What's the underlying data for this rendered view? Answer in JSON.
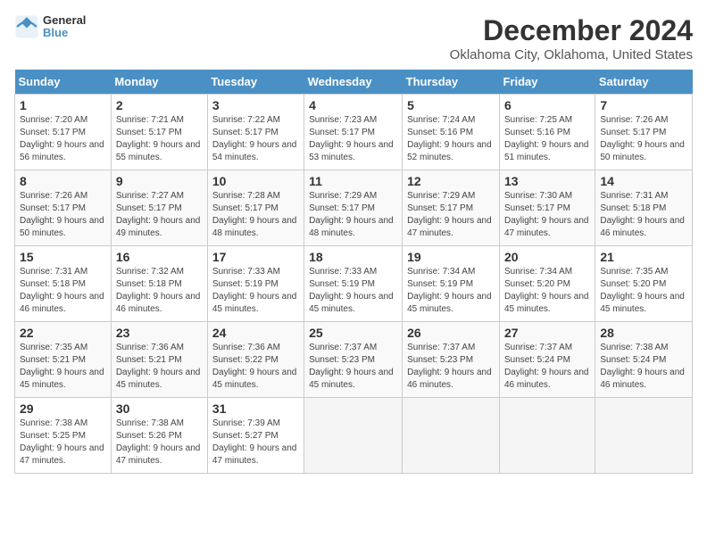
{
  "logo": {
    "text1": "General",
    "text2": "Blue"
  },
  "title": "December 2024",
  "subtitle": "Oklahoma City, Oklahoma, United States",
  "weekdays": [
    "Sunday",
    "Monday",
    "Tuesday",
    "Wednesday",
    "Thursday",
    "Friday",
    "Saturday"
  ],
  "weeks": [
    [
      {
        "day": "1",
        "sunrise": "7:20 AM",
        "sunset": "5:17 PM",
        "daylight": "9 hours and 56 minutes."
      },
      {
        "day": "2",
        "sunrise": "7:21 AM",
        "sunset": "5:17 PM",
        "daylight": "9 hours and 55 minutes."
      },
      {
        "day": "3",
        "sunrise": "7:22 AM",
        "sunset": "5:17 PM",
        "daylight": "9 hours and 54 minutes."
      },
      {
        "day": "4",
        "sunrise": "7:23 AM",
        "sunset": "5:17 PM",
        "daylight": "9 hours and 53 minutes."
      },
      {
        "day": "5",
        "sunrise": "7:24 AM",
        "sunset": "5:16 PM",
        "daylight": "9 hours and 52 minutes."
      },
      {
        "day": "6",
        "sunrise": "7:25 AM",
        "sunset": "5:16 PM",
        "daylight": "9 hours and 51 minutes."
      },
      {
        "day": "7",
        "sunrise": "7:26 AM",
        "sunset": "5:17 PM",
        "daylight": "9 hours and 50 minutes."
      }
    ],
    [
      {
        "day": "8",
        "sunrise": "7:26 AM",
        "sunset": "5:17 PM",
        "daylight": "9 hours and 50 minutes."
      },
      {
        "day": "9",
        "sunrise": "7:27 AM",
        "sunset": "5:17 PM",
        "daylight": "9 hours and 49 minutes."
      },
      {
        "day": "10",
        "sunrise": "7:28 AM",
        "sunset": "5:17 PM",
        "daylight": "9 hours and 48 minutes."
      },
      {
        "day": "11",
        "sunrise": "7:29 AM",
        "sunset": "5:17 PM",
        "daylight": "9 hours and 48 minutes."
      },
      {
        "day": "12",
        "sunrise": "7:29 AM",
        "sunset": "5:17 PM",
        "daylight": "9 hours and 47 minutes."
      },
      {
        "day": "13",
        "sunrise": "7:30 AM",
        "sunset": "5:17 PM",
        "daylight": "9 hours and 47 minutes."
      },
      {
        "day": "14",
        "sunrise": "7:31 AM",
        "sunset": "5:18 PM",
        "daylight": "9 hours and 46 minutes."
      }
    ],
    [
      {
        "day": "15",
        "sunrise": "7:31 AM",
        "sunset": "5:18 PM",
        "daylight": "9 hours and 46 minutes."
      },
      {
        "day": "16",
        "sunrise": "7:32 AM",
        "sunset": "5:18 PM",
        "daylight": "9 hours and 46 minutes."
      },
      {
        "day": "17",
        "sunrise": "7:33 AM",
        "sunset": "5:19 PM",
        "daylight": "9 hours and 45 minutes."
      },
      {
        "day": "18",
        "sunrise": "7:33 AM",
        "sunset": "5:19 PM",
        "daylight": "9 hours and 45 minutes."
      },
      {
        "day": "19",
        "sunrise": "7:34 AM",
        "sunset": "5:19 PM",
        "daylight": "9 hours and 45 minutes."
      },
      {
        "day": "20",
        "sunrise": "7:34 AM",
        "sunset": "5:20 PM",
        "daylight": "9 hours and 45 minutes."
      },
      {
        "day": "21",
        "sunrise": "7:35 AM",
        "sunset": "5:20 PM",
        "daylight": "9 hours and 45 minutes."
      }
    ],
    [
      {
        "day": "22",
        "sunrise": "7:35 AM",
        "sunset": "5:21 PM",
        "daylight": "9 hours and 45 minutes."
      },
      {
        "day": "23",
        "sunrise": "7:36 AM",
        "sunset": "5:21 PM",
        "daylight": "9 hours and 45 minutes."
      },
      {
        "day": "24",
        "sunrise": "7:36 AM",
        "sunset": "5:22 PM",
        "daylight": "9 hours and 45 minutes."
      },
      {
        "day": "25",
        "sunrise": "7:37 AM",
        "sunset": "5:23 PM",
        "daylight": "9 hours and 45 minutes."
      },
      {
        "day": "26",
        "sunrise": "7:37 AM",
        "sunset": "5:23 PM",
        "daylight": "9 hours and 46 minutes."
      },
      {
        "day": "27",
        "sunrise": "7:37 AM",
        "sunset": "5:24 PM",
        "daylight": "9 hours and 46 minutes."
      },
      {
        "day": "28",
        "sunrise": "7:38 AM",
        "sunset": "5:24 PM",
        "daylight": "9 hours and 46 minutes."
      }
    ],
    [
      {
        "day": "29",
        "sunrise": "7:38 AM",
        "sunset": "5:25 PM",
        "daylight": "9 hours and 47 minutes."
      },
      {
        "day": "30",
        "sunrise": "7:38 AM",
        "sunset": "5:26 PM",
        "daylight": "9 hours and 47 minutes."
      },
      {
        "day": "31",
        "sunrise": "7:39 AM",
        "sunset": "5:27 PM",
        "daylight": "9 hours and 47 minutes."
      },
      null,
      null,
      null,
      null
    ]
  ],
  "labels": {
    "sunrise": "Sunrise:",
    "sunset": "Sunset:",
    "daylight": "Daylight:"
  }
}
